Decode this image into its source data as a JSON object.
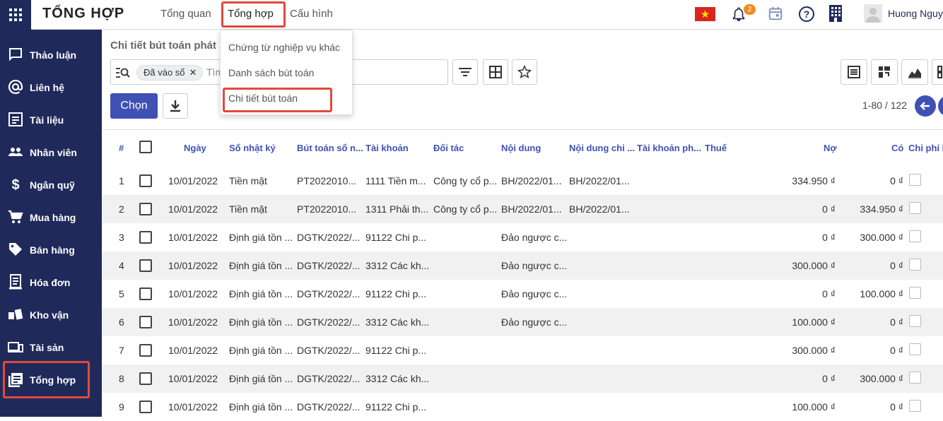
{
  "topbar": {
    "app_title": "TỔNG HỢP",
    "menus": [
      "Tổng quan",
      "Tổng hợp",
      "Cấu hình"
    ],
    "notification_count": "2",
    "user_name": "Huong Nguye"
  },
  "sidebar": {
    "items": [
      {
        "label": "Thảo luận",
        "icon": "chat-icon"
      },
      {
        "label": "Liên hệ",
        "icon": "at-icon"
      },
      {
        "label": "Tài liệu",
        "icon": "document-icon"
      },
      {
        "label": "Nhân viên",
        "icon": "people-icon"
      },
      {
        "label": "Ngân quỹ",
        "icon": "dollar-icon"
      },
      {
        "label": "Mua hàng",
        "icon": "cart-icon"
      },
      {
        "label": "Bán hàng",
        "icon": "tag-icon"
      },
      {
        "label": "Hóa đơn",
        "icon": "invoice-icon"
      },
      {
        "label": "Kho vận",
        "icon": "warehouse-icon"
      },
      {
        "label": "Tài sản",
        "icon": "assets-icon"
      },
      {
        "label": "Tổng hợp",
        "icon": "general-ledger-icon"
      }
    ]
  },
  "dropdown": {
    "items": [
      "Chứng từ nghiệp vụ khác",
      "Danh sách bút toán",
      "Chi tiết bút toán"
    ]
  },
  "main": {
    "breadcrumb": "Chi tiết bút toán phát si",
    "facet_label": "Đã vào sổ",
    "search_placeholder": "Tìm",
    "chon_label": "Chọn",
    "pager": "1-80 / 122"
  },
  "table": {
    "headers": [
      "#",
      "Ngày",
      "Sổ nhật ký",
      "Bút toán sổ n...",
      "Tài khoản",
      "Đối tác",
      "Nội dung",
      "Nội dung chi ...",
      "Tài khoản ph...",
      "Thuế",
      "Nợ",
      "Có",
      "Chi phí k"
    ],
    "rows": [
      {
        "no": "1",
        "date": "10/01/2022",
        "journal": "Tiền mặt",
        "entry": "PT2022010...",
        "account": "1111 Tiền m...",
        "partner": "Công ty cổ p...",
        "content": "BH/2022/01...",
        "detail": "BH/2022/01...",
        "debit": "334.950 ₫",
        "credit": "0 ₫"
      },
      {
        "no": "2",
        "date": "10/01/2022",
        "journal": "Tiền mặt",
        "entry": "PT2022010...",
        "account": "1311 Phải th...",
        "partner": "Công ty cổ p...",
        "content": "BH/2022/01...",
        "detail": "BH/2022/01...",
        "debit": "0 ₫",
        "credit": "334.950 ₫"
      },
      {
        "no": "3",
        "date": "10/01/2022",
        "journal": "Định giá tồn ...",
        "entry": "DGTK/2022/...",
        "account": "91122 Chi p...",
        "partner": "",
        "content": "Đảo ngược c...",
        "detail": "",
        "debit": "0 ₫",
        "credit": "300.000 ₫"
      },
      {
        "no": "4",
        "date": "10/01/2022",
        "journal": "Định giá tồn ...",
        "entry": "DGTK/2022/...",
        "account": "3312 Các kh...",
        "partner": "",
        "content": "Đảo ngược c...",
        "detail": "",
        "debit": "300.000 ₫",
        "credit": "0 ₫"
      },
      {
        "no": "5",
        "date": "10/01/2022",
        "journal": "Định giá tồn ...",
        "entry": "DGTK/2022/...",
        "account": "91122 Chi p...",
        "partner": "",
        "content": "Đảo ngược c...",
        "detail": "",
        "debit": "0 ₫",
        "credit": "100.000 ₫"
      },
      {
        "no": "6",
        "date": "10/01/2022",
        "journal": "Định giá tồn ...",
        "entry": "DGTK/2022/...",
        "account": "3312 Các kh...",
        "partner": "",
        "content": "Đảo ngược c...",
        "detail": "",
        "debit": "100.000 ₫",
        "credit": "0 ₫"
      },
      {
        "no": "7",
        "date": "10/01/2022",
        "journal": "Định giá tồn ...",
        "entry": "DGTK/2022/...",
        "account": "91122 Chi p...",
        "partner": "",
        "content": "",
        "detail": "",
        "debit": "300.000 ₫",
        "credit": "0 ₫"
      },
      {
        "no": "8",
        "date": "10/01/2022",
        "journal": "Định giá tồn ...",
        "entry": "DGTK/2022/...",
        "account": "3312 Các kh...",
        "partner": "",
        "content": "",
        "detail": "",
        "debit": "0 ₫",
        "credit": "300.000 ₫"
      },
      {
        "no": "9",
        "date": "10/01/2022",
        "journal": "Định giá tồn ...",
        "entry": "DGTK/2022/...",
        "account": "91122 Chi p...",
        "partner": "",
        "content": "",
        "detail": "",
        "debit": "100.000 ₫",
        "credit": "0 ₫"
      }
    ]
  },
  "colors": {
    "sidebar_bg": "#1f2a5b",
    "accent": "#3f51b5",
    "highlight_box": "#e1493d",
    "badge": "#f28c1e"
  }
}
